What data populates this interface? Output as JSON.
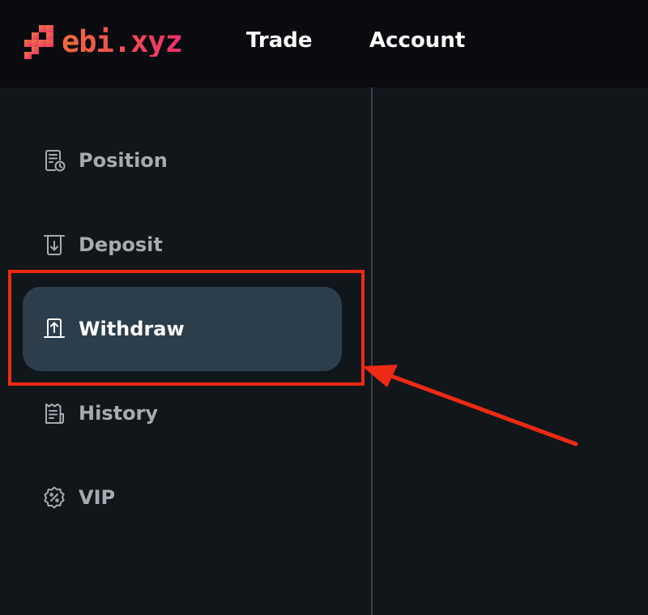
{
  "header": {
    "brand": "ebi.xyz",
    "nav": [
      {
        "label": "Trade"
      },
      {
        "label": "Account"
      }
    ]
  },
  "sidebar": {
    "items": [
      {
        "label": "Position",
        "icon": "position-icon"
      },
      {
        "label": "Deposit",
        "icon": "deposit-icon"
      },
      {
        "label": "Withdraw",
        "icon": "withdraw-icon",
        "active": true
      },
      {
        "label": "History",
        "icon": "history-icon"
      },
      {
        "label": "VIP",
        "icon": "vip-badge-icon"
      }
    ]
  },
  "colors": {
    "brand_gradient_start": "#f06a3c",
    "brand_gradient_end": "#ec2f6c",
    "header_bg": "#0a0b0e",
    "page_bg": "#11161b",
    "active_item_bg": "#2c3e4c",
    "annotation": "#ee2a14"
  }
}
